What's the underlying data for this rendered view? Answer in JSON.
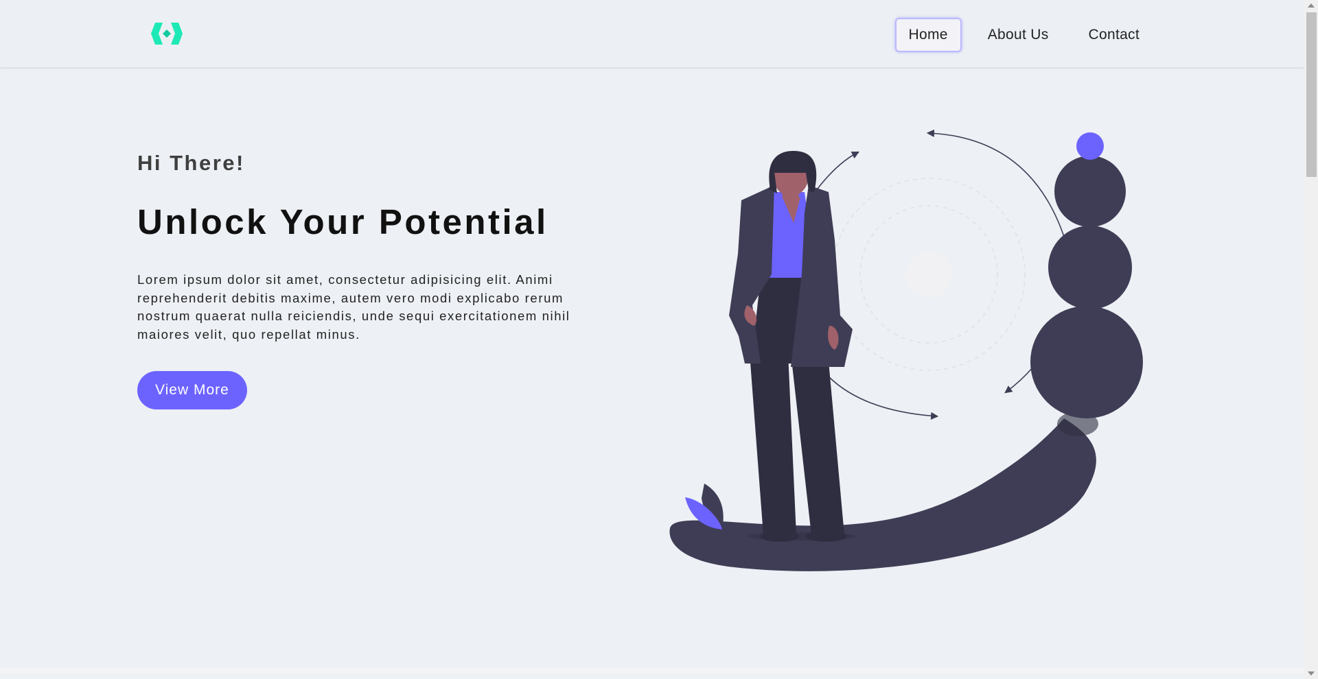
{
  "nav": {
    "items": [
      {
        "label": "Home",
        "active": true
      },
      {
        "label": "About Us",
        "active": false
      },
      {
        "label": "Contact",
        "active": false
      }
    ]
  },
  "logo": {
    "icon": "code-brackets-icon",
    "color": "#1de9b6"
  },
  "hero": {
    "greeting": "Hi There!",
    "headline": "Unlock Your Potential",
    "description": "Lorem ipsum dolor sit amet, consectetur adipisicing elit. Animi reprehenderit debitis maxime, autem vero modi explicabo rerum nostrum quaerat nulla reiciendis, unde sequi exercitationem nihil maiores velit, quo repellat minus.",
    "cta_label": "View More"
  },
  "colors": {
    "accent": "#6c63ff",
    "dark": "#3f3d56",
    "skin": "#a0616a",
    "background": "#edf0f4"
  }
}
